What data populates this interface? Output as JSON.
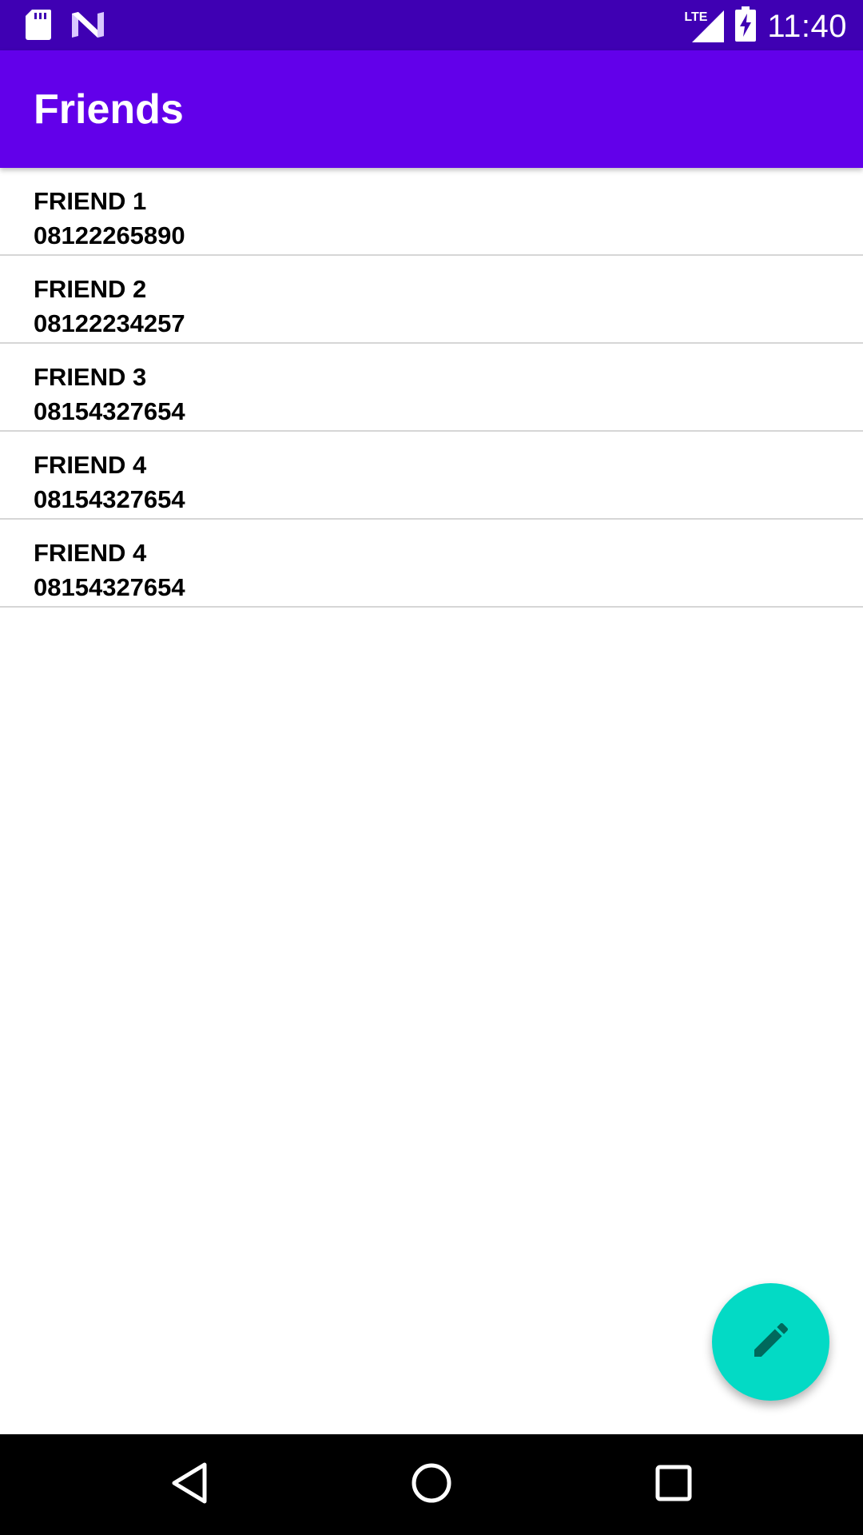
{
  "status_bar": {
    "time": "11:40",
    "network_label": "LTE",
    "icons": [
      "sd-card-icon",
      "n-logo-icon",
      "signal-icon",
      "battery-charging-icon"
    ]
  },
  "app_bar": {
    "title": "Friends"
  },
  "friends": [
    {
      "name": "FRIEND 1",
      "phone": "08122265890"
    },
    {
      "name": "FRIEND 2",
      "phone": "08122234257"
    },
    {
      "name": "FRIEND 3",
      "phone": "08154327654"
    },
    {
      "name": "FRIEND 4",
      "phone": "08154327654"
    },
    {
      "name": "FRIEND 4",
      "phone": "08154327654"
    }
  ],
  "fab": {
    "icon": "pencil-icon",
    "color": "#03dac5"
  },
  "nav_bar": {
    "buttons": [
      "back-icon",
      "home-icon",
      "recents-icon"
    ]
  },
  "colors": {
    "primary": "#6200ea",
    "primary_dark": "#3f00b3",
    "accent": "#03dac5"
  }
}
